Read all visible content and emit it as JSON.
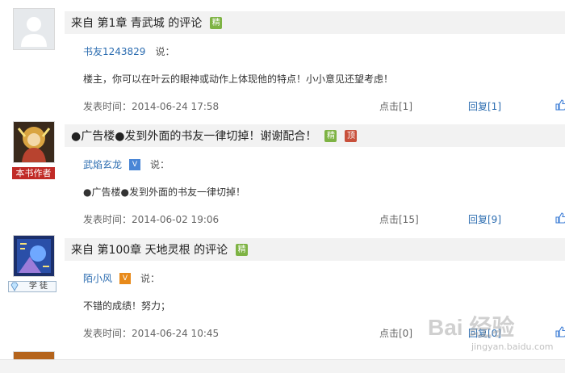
{
  "posts": [
    {
      "title": "来自 第1章 青武城 的评论",
      "tags": [
        "精"
      ],
      "user": "书友1243829",
      "say": "说：",
      "content": "楼主，你可以在叶云的眼神或动作上体现他的特点！小小意见还望考虑！",
      "time_label": "发表时间：2014-06-24 17:58",
      "clicks": "点击[1]",
      "replies": "回复[1]"
    },
    {
      "title": "●广告楼●发到外面的书友一律切掉！谢谢配合！",
      "tags": [
        "精",
        "顶"
      ],
      "role_label": "本书作者",
      "user": "武焰玄龙",
      "level_badge": "V",
      "say": "说：",
      "content": "●广告楼●发到外面的书友一律切掉！",
      "time_label": "发表时间：2014-06-02 19:06",
      "clicks": "点击[15]",
      "replies": "回复[9]"
    },
    {
      "title": "来自 第100章 天地灵根 的评论",
      "tags": [
        "精"
      ],
      "rank_badge": "学 徒",
      "user": "陌小风",
      "level_badge": "V",
      "say": "说：",
      "content": "不错的成绩！努力；",
      "time_label": "发表时间：2014-06-24 10:45",
      "clicks": "点击[0]",
      "replies": "回复[0]"
    }
  ],
  "watermark": {
    "brand": "Bai 经验",
    "url": "jingyan.baidu.com"
  },
  "colors": {
    "link": "#2b6cb0",
    "jing_tag": "#7eb344",
    "ding_tag": "#c8503b",
    "author_label": "#c12b27",
    "title_bar": "#f2f2f2"
  },
  "icons": [
    "default-avatar-icon",
    "like-icon",
    "gem-icon",
    "vip-badge-icon"
  ]
}
